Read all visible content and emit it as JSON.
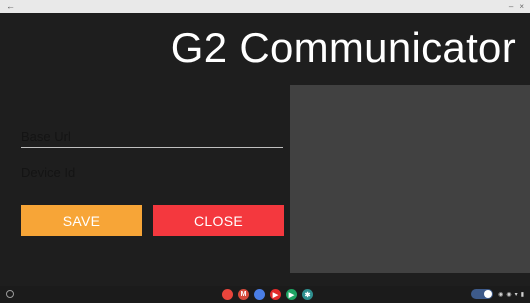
{
  "titlebar": {
    "back_icon": "←",
    "minimize_icon": "–",
    "close_icon": "×"
  },
  "app": {
    "title": "G2 Communicator"
  },
  "form": {
    "base_url": {
      "placeholder": "Base Url",
      "value": ""
    },
    "device_id": {
      "placeholder": "Device Id",
      "value": ""
    }
  },
  "buttons": {
    "save": "SAVE",
    "close": "CLOSE"
  },
  "colors": {
    "save_button": "#f7a537",
    "close_button": "#f4383e",
    "panel": "#414141",
    "background": "#1e1e1e"
  },
  "shelf": {
    "apps": [
      {
        "name": "chrome-icon",
        "glyph": "",
        "color": "#e8453c"
      },
      {
        "name": "gmail-icon",
        "glyph": "M",
        "color": "#d64a3b"
      },
      {
        "name": "docs-icon",
        "glyph": "",
        "color": "#4a7ee6"
      },
      {
        "name": "youtube-icon",
        "glyph": "▶",
        "color": "#e22a2a"
      },
      {
        "name": "play-store-icon",
        "glyph": "▶",
        "color": "#1fa463"
      },
      {
        "name": "settings-icon",
        "glyph": "✱",
        "color": "#2f8f8f"
      }
    ],
    "tray_icons": [
      "◉",
      "◉",
      "▾",
      "▮"
    ]
  }
}
